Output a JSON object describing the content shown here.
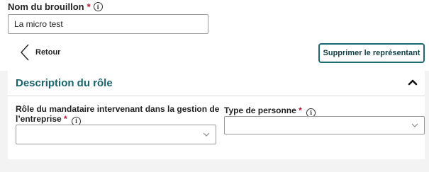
{
  "draft": {
    "label": "Nom du brouillon",
    "required_mark": "*",
    "info_icon": "info-icon",
    "value": "La micro test"
  },
  "back": {
    "label": "Retour",
    "icon": "chevron-left-icon"
  },
  "delete_button": {
    "label": "Supprimer le représentant"
  },
  "panel": {
    "title": "Description du rôle",
    "collapse_icon": "chevron-up-icon",
    "fields": {
      "role": {
        "label": "Rôle du mandataire intervenant dans la gestion de l’entreprise",
        "required_mark": "*",
        "info_icon": "info-icon",
        "value": ""
      },
      "person_type": {
        "label": "Type de personne",
        "required_mark": "*",
        "info_icon": "info-icon",
        "value": ""
      }
    }
  },
  "colors": {
    "accent": "#18636b",
    "button_border": "#1a6b73",
    "required": "#c8102e",
    "background": "#f3f3f3"
  }
}
